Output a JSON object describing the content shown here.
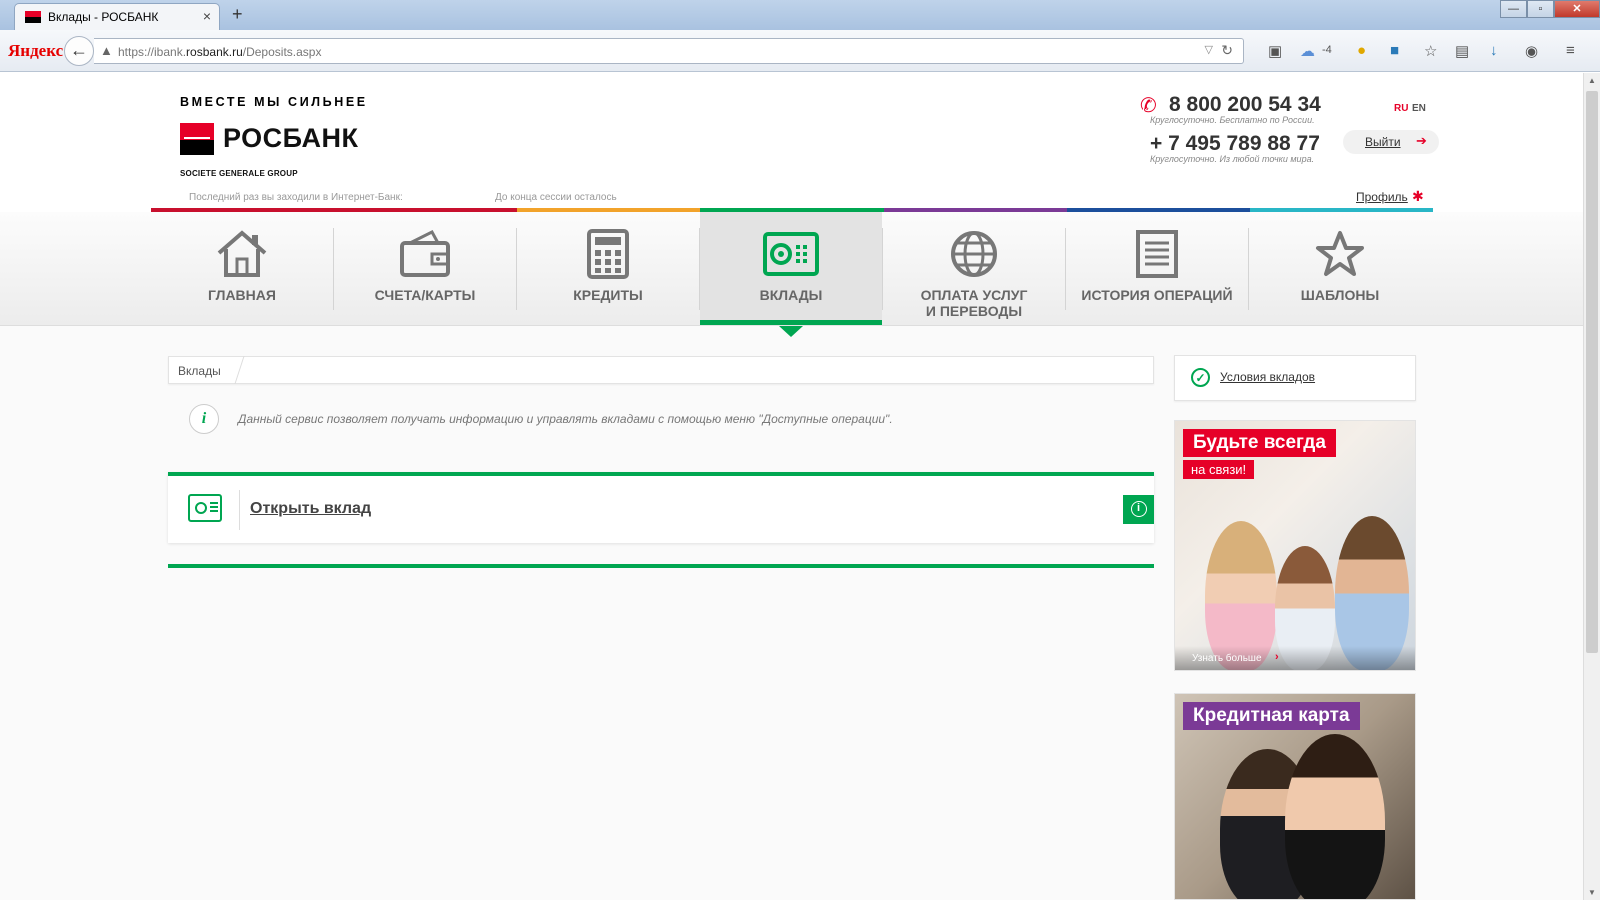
{
  "browser": {
    "tab_title": "Вклады - РОСБАНК",
    "close": "×",
    "new_tab": "+",
    "search_brand": "Яндекс",
    "url_host_prefix": "https://ibank.",
    "url_host": "rosbank.ru",
    "url_path": "/Deposits.aspx",
    "weather": "-4",
    "window": {
      "minimize": "—",
      "maximize": "▫",
      "close": "✕"
    }
  },
  "header": {
    "slogan": "ВМЕСТЕ МЫ СИЛЬНЕЕ",
    "brand": "РОСБАНК",
    "group": "SOCIETE GENERALE GROUP",
    "phone1": "8 800 200 54 34",
    "phone1_note": "Круглосуточно. Бесплатно по России.",
    "phone2": "+ 7 495 789 88 77",
    "phone2_note": "Круглосуточно. Из любой точки мира.",
    "lang_ru": "RU",
    "lang_en": "EN",
    "logout": "Выйти",
    "last_visit": "Последний раз вы заходили в Интернет-Банк:",
    "session": "До конца сессии осталось",
    "profile": "Профиль"
  },
  "stripe_colors": [
    "#c8102e",
    "#c8102e",
    "#f2a32b",
    "#00a651",
    "#7b3a96",
    "#1c4f9c",
    "#29b6c6"
  ],
  "menu": [
    {
      "label": "ГЛАВНАЯ",
      "icon": "home-icon"
    },
    {
      "label": "СЧЕТА/КАРТЫ",
      "icon": "wallet-icon"
    },
    {
      "label": "КРЕДИТЫ",
      "icon": "calculator-icon"
    },
    {
      "label": "ВКЛАДЫ",
      "icon": "safe-icon",
      "active": true
    },
    {
      "label": "ОПЛАТА УСЛУГ",
      "label2": "И ПЕРЕВОДЫ",
      "icon": "globe-icon"
    },
    {
      "label": "ИСТОРИЯ ОПЕРАЦИЙ",
      "icon": "document-icon"
    },
    {
      "label": "ШАБЛОНЫ",
      "icon": "star-icon"
    }
  ],
  "breadcrumb": "Вклады",
  "info_text": "Данный сервис позволяет получать информацию и управлять вкладами с помощью меню \"Доступные операции\".",
  "open_deposit": "Открыть вклад",
  "sidebar": {
    "conditions_link": "Условия вкладов",
    "banner1_title": "Будьте всегда",
    "banner1_sub": "на связи!",
    "banner1_more": "Узнать больше",
    "banner2_title": "Кредитная карта"
  },
  "colors": {
    "accent": "#00a651",
    "brand_red": "#e60028",
    "purple": "#7b3a96"
  }
}
